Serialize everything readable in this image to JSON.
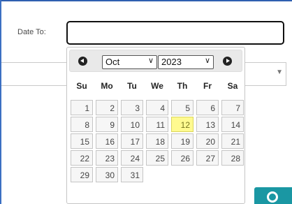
{
  "form": {
    "date_to_label": "Date To:",
    "date_to_value": ""
  },
  "datepicker": {
    "month": "Oct",
    "year": "2023",
    "weekdays": [
      "Su",
      "Mo",
      "Tu",
      "We",
      "Th",
      "Fr",
      "Sa"
    ],
    "days": [
      "1",
      "2",
      "3",
      "4",
      "5",
      "6",
      "7",
      "8",
      "9",
      "10",
      "11",
      "12",
      "13",
      "14",
      "15",
      "16",
      "17",
      "18",
      "19",
      "20",
      "21",
      "22",
      "23",
      "24",
      "25",
      "26",
      "27",
      "28",
      "29",
      "30",
      "31"
    ],
    "today": "12"
  },
  "colors": {
    "accent": "#3b6fc2",
    "today_bg": "#fffa90",
    "button": "#1a97a3"
  }
}
